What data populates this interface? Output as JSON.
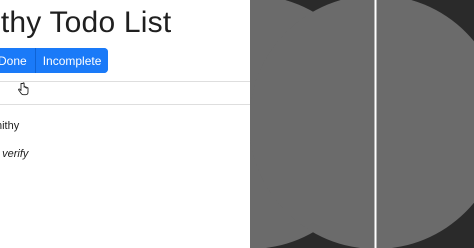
{
  "app": {
    "title": "ithy Todo List",
    "filters": [
      {
        "label": "Done"
      },
      {
        "label": "Incomplete"
      }
    ],
    "todos": [
      {
        "text": "nithy"
      },
      {
        "text": "t verify"
      }
    ]
  },
  "overlay": {
    "background_color": "#2a2a2a",
    "shape_color": "#6b6b6b",
    "divider_color": "#ffffff"
  }
}
